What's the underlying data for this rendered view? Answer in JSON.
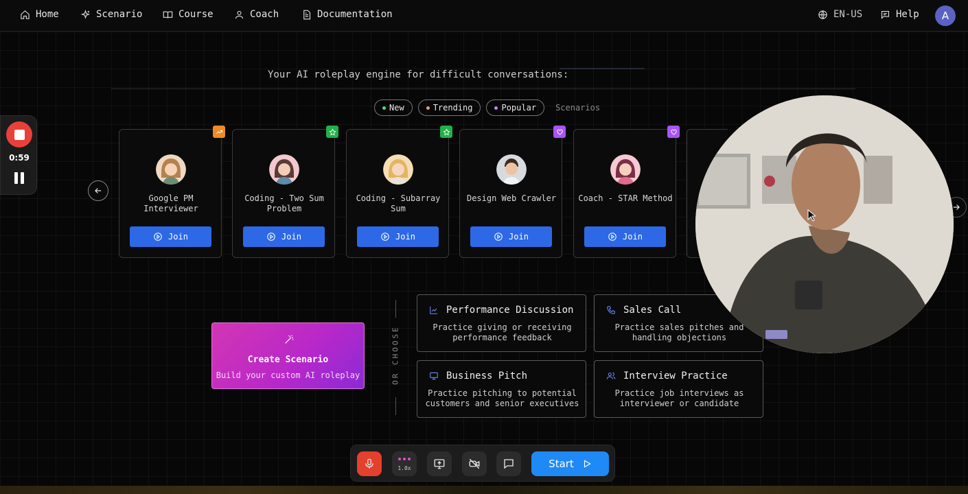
{
  "nav": {
    "items": [
      {
        "label": "Home",
        "icon": "home-icon"
      },
      {
        "label": "Scenario",
        "icon": "sparkles-icon"
      },
      {
        "label": "Course",
        "icon": "book-icon"
      },
      {
        "label": "Coach",
        "icon": "user-icon"
      },
      {
        "label": "Documentation",
        "icon": "document-icon"
      }
    ],
    "language": "EN-US",
    "help": "Help",
    "avatar_initial": "A"
  },
  "tagline": "Your AI roleplay engine for difficult conversations:",
  "filters": {
    "pills": [
      {
        "label": "New",
        "color": "#4ade80"
      },
      {
        "label": "Trending",
        "color": "#f59e5b"
      },
      {
        "label": "Popular",
        "color": "#c084fc"
      }
    ],
    "label": "Scenarios"
  },
  "recording": {
    "time": "0:59"
  },
  "scenarios": [
    {
      "title": "Google PM Interviewer",
      "badge": "trending",
      "badge_color": "#f08a24",
      "join": "Join"
    },
    {
      "title": "Coding - Two Sum Problem",
      "badge": "star",
      "badge_color": "#22b04a",
      "join": "Join"
    },
    {
      "title": "Coding - Subarray Sum",
      "badge": "star",
      "badge_color": "#22b04a",
      "join": "Join"
    },
    {
      "title": "Design Web Crawler",
      "badge": "heart",
      "badge_color": "#a855f7",
      "join": "Join"
    },
    {
      "title": "Coach - STAR Method",
      "badge": "heart",
      "badge_color": "#a855f7",
      "join": "Join"
    }
  ],
  "create": {
    "title": "Create Scenario",
    "subtitle": "Build your custom AI roleplay"
  },
  "or_choose": "OR CHOOSE",
  "choices": [
    {
      "title": "Performance Discussion",
      "desc": "Practice giving or receiving performance feedback",
      "icon": "chart-icon"
    },
    {
      "title": "Sales Call",
      "desc": "Practice sales pitches and handling objections",
      "icon": "phone-icon"
    },
    {
      "title": "Business Pitch",
      "desc": "Practice pitching to potential customers and senior executives",
      "icon": "monitor-icon"
    },
    {
      "title": "Interview Practice",
      "desc": "Practice job interviews as interviewer or candidate",
      "icon": "users-icon"
    }
  ],
  "toolbar": {
    "speed": "1.0x",
    "start": "Start"
  }
}
